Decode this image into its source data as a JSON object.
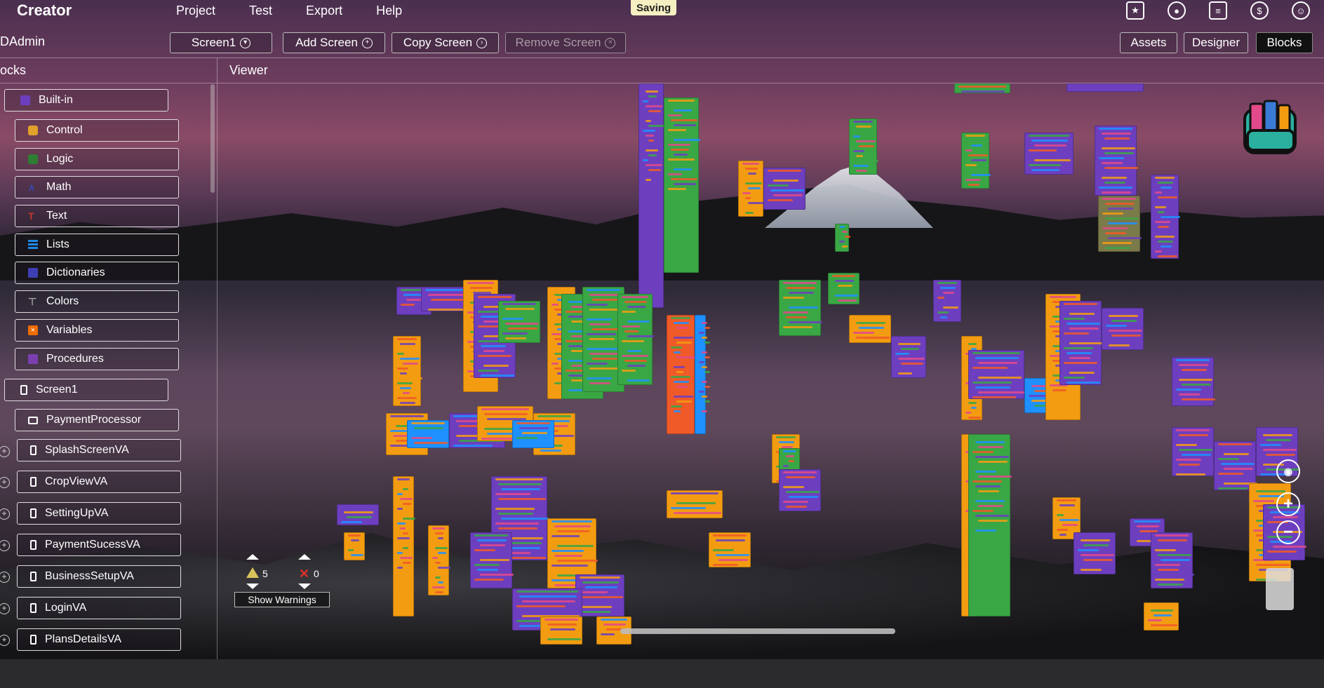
{
  "app": {
    "title": "Creator",
    "status_badge": "Saving"
  },
  "menu": [
    "Project",
    "Test",
    "Export",
    "Help"
  ],
  "top_icons": [
    "folder-star-icon",
    "palette-icon",
    "docs-icon",
    "dollar-icon",
    "account-icon"
  ],
  "project": {
    "name": "DAdmin"
  },
  "screen_controls": {
    "current_screen": "Screen1",
    "add_screen": "Add Screen",
    "copy_screen": "Copy Screen",
    "remove_screen": "Remove Screen"
  },
  "views": {
    "assets": "Assets",
    "designer": "Designer",
    "blocks": "Blocks",
    "active": "Blocks"
  },
  "panel": {
    "title": "ocks"
  },
  "viewer": {
    "title": "Viewer"
  },
  "builtin": {
    "label": "Built-in",
    "items": [
      {
        "label": "Control",
        "color": "#e1a02b"
      },
      {
        "label": "Logic",
        "color": "#2e7d32"
      },
      {
        "label": "Math",
        "color": "#3949ab"
      },
      {
        "label": "Text",
        "color": "#c0392b"
      },
      {
        "label": "Lists",
        "color": "#1e88e5"
      },
      {
        "label": "Dictionaries",
        "color": "#3f3fb5"
      },
      {
        "label": "Colors",
        "color": "#9e9e9e"
      },
      {
        "label": "Variables",
        "color": "#ef6c00"
      },
      {
        "label": "Procedures",
        "color": "#7b3fb0"
      }
    ]
  },
  "screen1": {
    "label": "Screen1",
    "components": [
      "PaymentProcessor",
      "SplashScreenVA",
      "CropViewVA",
      "SettingUpVA",
      "PaymentSucessVA",
      "BusinessSetupVA",
      "LoginVA",
      "PlansDetailsVA"
    ]
  },
  "warnings": {
    "warning_count": "5",
    "error_count": "0",
    "toggle_label": "Show Warnings"
  },
  "palette": {
    "purple": "#6d3fbf",
    "orange": "#f39c12",
    "green": "#3aa745",
    "blue": "#1e90ff",
    "red": "#f05a28",
    "olive": "#7a7a4a",
    "pink": "#e24a8a"
  }
}
